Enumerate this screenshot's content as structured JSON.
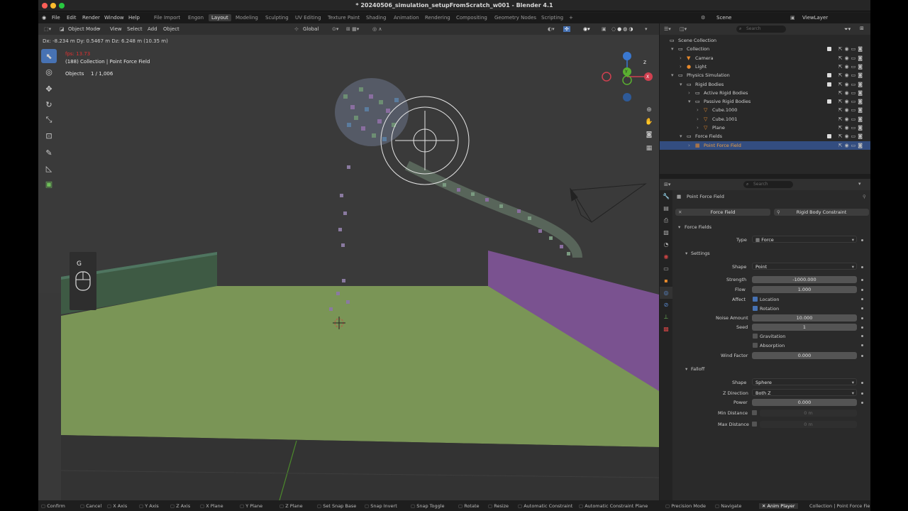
{
  "window": {
    "title": "* 20240506_simulation_setupFromScratch_w001 - Blender 4.1"
  },
  "menu": {
    "items": [
      "File",
      "Edit",
      "Render",
      "Window",
      "Help"
    ],
    "workspaces": [
      "File Import",
      "Engon",
      "Layout",
      "Modeling",
      "Sculpting",
      "UV Editing",
      "Texture Paint",
      "Shading",
      "Animation",
      "Rendering",
      "Compositing",
      "Geometry Nodes",
      "Scripting"
    ],
    "add_tab": "+",
    "scene_label": "Scene",
    "viewlayer_label": "ViewLayer"
  },
  "viewport": {
    "header": {
      "mode": "Object Mode",
      "view": "View",
      "select": "Select",
      "add": "Add",
      "object": "Object",
      "orientation": "Global"
    },
    "transform_info": "Dx: -8.234 m   Dy: 0.5467 m   Dz: 6.248 m (10.35 m)",
    "fps": "fps: 13.73",
    "collection": "(188) Collection | Point Force Field",
    "objects_label": "Objects",
    "objects_count": "1 / 1,006",
    "key_overlay": "G",
    "gizmo": {
      "z": "Z",
      "y": "Y",
      "x": "X"
    }
  },
  "outliner": {
    "search_placeholder": "Search",
    "rows": [
      {
        "label": "Scene Collection",
        "indent": 0
      },
      {
        "label": "Collection",
        "indent": 1
      },
      {
        "label": "Camera",
        "indent": 2
      },
      {
        "label": "Light",
        "indent": 2
      },
      {
        "label": "Physics Simulation",
        "indent": 1
      },
      {
        "label": "Rigid Bodies",
        "indent": 2
      },
      {
        "label": "Active Rigid Bodies",
        "indent": 3
      },
      {
        "label": "Passive Rigid Bodies",
        "indent": 3
      },
      {
        "label": "Cube.1000",
        "indent": 4
      },
      {
        "label": "Cube.1001",
        "indent": 4
      },
      {
        "label": "Plane",
        "indent": 4
      },
      {
        "label": "Force Fields",
        "indent": 2
      },
      {
        "label": "Point Force Field",
        "indent": 3
      }
    ]
  },
  "properties": {
    "search_placeholder": "Search",
    "object_name": "Point Force Field",
    "tab_force_field": "Force Field",
    "tab_rigid_body_constraint": "Rigid Body Constraint",
    "panel_force_fields": "Force Fields",
    "type_label": "Type",
    "type_value": "Force",
    "settings_label": "Settings",
    "shape_label": "Shape",
    "shape_value": "Point",
    "strength_label": "Strength",
    "strength_value": "-1000.000",
    "flow_label": "Flow",
    "flow_value": "1.000",
    "affect_label": "Affect",
    "location_label": "Location",
    "rotation_label": "Rotation",
    "noise_label": "Noise Amount",
    "noise_value": "10.000",
    "seed_label": "Seed",
    "seed_value": "1",
    "gravitation_label": "Gravitation",
    "absorption_label": "Absorption",
    "wind_label": "Wind Factor",
    "wind_value": "0.000",
    "falloff_label": "Falloff",
    "falloff_shape_label": "Shape",
    "falloff_shape_value": "Sphere",
    "zdir_label": "Z Direction",
    "zdir_value": "Both Z",
    "power_label": "Power",
    "power_value": "0.000",
    "min_label": "Min Distance",
    "min_value": "0 m",
    "max_label": "Max Distance",
    "max_value": "0 m"
  },
  "status": {
    "items": [
      "Confirm",
      "Cancel",
      "X Axis",
      "Y Axis",
      "Z Axis",
      "X Plane",
      "Y Plane",
      "Z Plane",
      "Set Snap Base",
      "Snap Invert",
      "Snap Toggle",
      "Rotate",
      "Resize",
      "Automatic Constraint",
      "Automatic Constraint Plane",
      "Precision Mode",
      "Navigate"
    ],
    "anim_player": "Anim Player",
    "right": "Collection | Point Force Fie"
  },
  "colors": {
    "accent": "#4772b3",
    "ground": "#7a9556",
    "wall_purple": "#7a5290",
    "wall_green": "#3e5a44",
    "selected_row": "#334d80"
  }
}
